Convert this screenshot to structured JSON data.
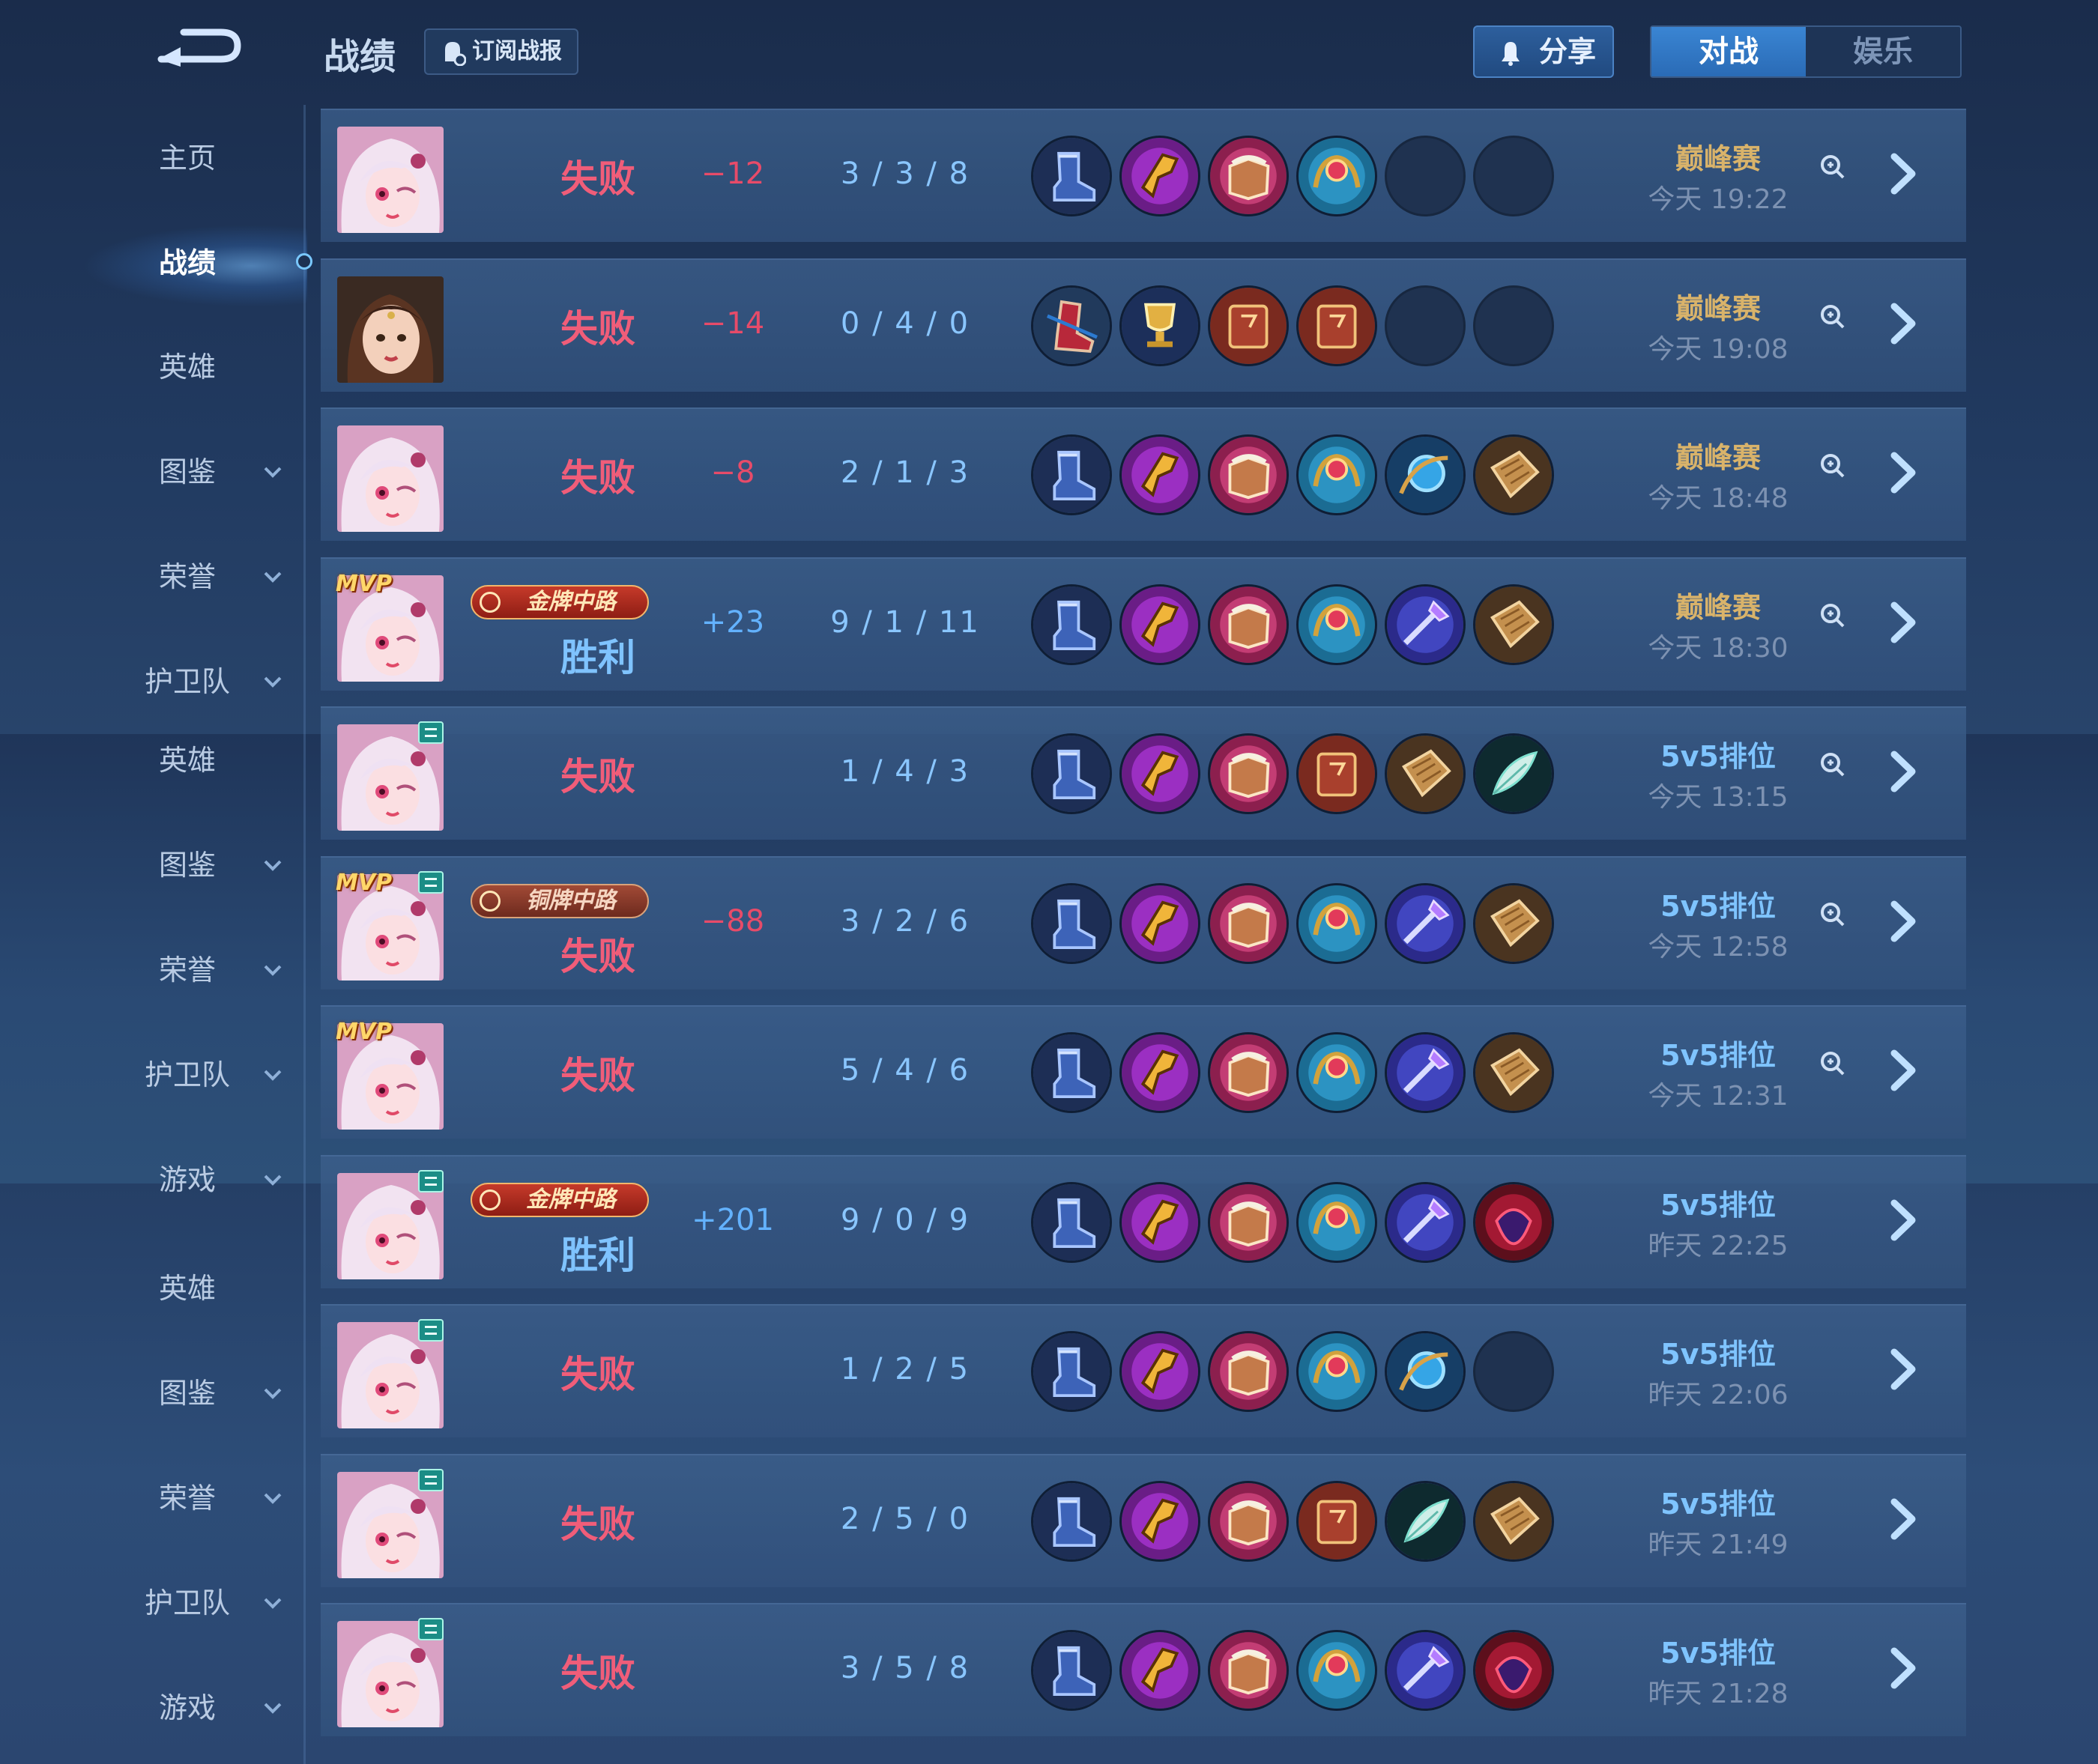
{
  "header": {
    "title": "战绩",
    "subscribe_label": "订阅战报",
    "share_label": "分享",
    "tabs": [
      "对战",
      "娱乐"
    ]
  },
  "sidebar": {
    "items": [
      {
        "label": "主页",
        "chevron": false
      },
      {
        "label": "战绩",
        "chevron": false,
        "active": true
      },
      {
        "label": "英雄",
        "chevron": false
      },
      {
        "label": "图鉴",
        "chevron": true
      },
      {
        "label": "荣誉",
        "chevron": true
      },
      {
        "label": "护卫队",
        "chevron": true
      },
      {
        "label": "英雄",
        "chevron": false
      },
      {
        "label": "图鉴",
        "chevron": true
      },
      {
        "label": "荣誉",
        "chevron": true
      },
      {
        "label": "护卫队",
        "chevron": true
      },
      {
        "label": "游戏",
        "chevron": true
      },
      {
        "label": "英雄",
        "chevron": false
      },
      {
        "label": "图鉴",
        "chevron": true
      },
      {
        "label": "荣誉",
        "chevron": true
      },
      {
        "label": "护卫队",
        "chevron": true
      },
      {
        "label": "游戏",
        "chevron": true
      }
    ]
  },
  "colors": {
    "loss": "#f05d79",
    "win": "#7fc3ff",
    "peak_mode": "#d9b36a",
    "rank_mode": "#7fc4ff",
    "accent": "#3a85d3"
  },
  "matches": [
    {
      "hero": "pink-hair-hero",
      "mvp": "",
      "rank_tag": false,
      "medal": "",
      "result": "失败",
      "score": "−12",
      "kda": "3 / 3 / 8",
      "items": [
        "boots",
        "golden-hammer",
        "tome",
        "orb-staff",
        "empty",
        "empty"
      ],
      "mode": "巅峰赛",
      "time": "今天 19:22",
      "detail_icon": true
    },
    {
      "hero": "brown-hair-hero",
      "mvp": "",
      "rank_tag": false,
      "medal": "",
      "result": "失败",
      "score": "−14",
      "kda": "0 / 4 / 0",
      "items": [
        "red-boots",
        "golden-cup",
        "red-tome",
        "red-tome",
        "empty",
        "empty"
      ],
      "mode": "巅峰赛",
      "time": "今天 19:08",
      "detail_icon": true
    },
    {
      "hero": "pink-hair-hero",
      "mvp": "",
      "rank_tag": false,
      "medal": "",
      "result": "失败",
      "score": "−8",
      "kda": "2 / 1 / 3",
      "items": [
        "boots",
        "golden-hammer",
        "tome",
        "orb-staff",
        "blue-orb",
        "wood-shield"
      ],
      "mode": "巅峰赛",
      "time": "今天 18:48",
      "detail_icon": true
    },
    {
      "hero": "pink-hair-hero",
      "mvp": "MVP",
      "rank_tag": false,
      "medal": "金牌中路",
      "medal_tier": "gold",
      "result": "胜利",
      "score": "+23",
      "kda": "9 / 1 / 11",
      "items": [
        "boots",
        "golden-hammer",
        "tome",
        "orb-staff",
        "purple-scepter",
        "wood-shield"
      ],
      "mode": "巅峰赛",
      "time": "今天 18:30",
      "detail_icon": true
    },
    {
      "hero": "pink-hair-hero",
      "mvp": "",
      "rank_tag": true,
      "medal": "",
      "result": "失败",
      "score": "",
      "kda": "1 / 4 / 3",
      "items": [
        "boots",
        "golden-hammer",
        "tome",
        "red-tome",
        "wood-shield",
        "feather"
      ],
      "mode": "5v5排位",
      "time": "今天 13:15",
      "detail_icon": true
    },
    {
      "hero": "pink-hair-hero",
      "mvp": "MVP",
      "rank_tag": true,
      "medal": "铜牌中路",
      "medal_tier": "bronze",
      "result": "失败",
      "score": "−88",
      "kda": "3 / 2 / 6",
      "items": [
        "boots",
        "golden-hammer",
        "tome",
        "orb-staff",
        "purple-scepter",
        "wood-shield"
      ],
      "mode": "5v5排位",
      "time": "今天 12:58",
      "detail_icon": true
    },
    {
      "hero": "pink-hair-hero",
      "mvp": "MVP",
      "rank_tag": false,
      "medal": "",
      "result": "失败",
      "score": "",
      "kda": "5 / 4 / 6",
      "items": [
        "boots",
        "golden-hammer",
        "tome",
        "orb-staff",
        "purple-scepter",
        "wood-shield"
      ],
      "mode": "5v5排位",
      "time": "今天 12:31",
      "detail_icon": true
    },
    {
      "hero": "pink-hair-hero",
      "mvp": "",
      "rank_tag": true,
      "medal": "金牌中路",
      "medal_tier": "gold",
      "result": "胜利",
      "score": "+201",
      "kda": "9 / 0 / 9",
      "items": [
        "boots",
        "golden-hammer",
        "tome",
        "orb-staff",
        "purple-scepter",
        "crimson-mask"
      ],
      "mode": "5v5排位",
      "time": "昨天 22:25",
      "detail_icon": false
    },
    {
      "hero": "pink-hair-hero",
      "mvp": "",
      "rank_tag": true,
      "medal": "",
      "result": "失败",
      "score": "",
      "kda": "1 / 2 / 5",
      "items": [
        "boots",
        "golden-hammer",
        "tome",
        "orb-staff",
        "blue-orb",
        "empty"
      ],
      "mode": "5v5排位",
      "time": "昨天 22:06",
      "detail_icon": false
    },
    {
      "hero": "pink-hair-hero",
      "mvp": "",
      "rank_tag": true,
      "medal": "",
      "result": "失败",
      "score": "",
      "kda": "2 / 5 / 0",
      "items": [
        "boots",
        "golden-hammer",
        "tome",
        "red-tome",
        "feather",
        "wood-shield"
      ],
      "mode": "5v5排位",
      "time": "昨天 21:49",
      "detail_icon": false
    },
    {
      "hero": "pink-hair-hero",
      "mvp": "",
      "rank_tag": true,
      "medal": "",
      "result": "失败",
      "score": "",
      "kda": "3 / 5 / 8",
      "items": [
        "boots",
        "golden-hammer",
        "tome",
        "orb-staff",
        "purple-scepter",
        "crimson-mask"
      ],
      "mode": "5v5排位",
      "time": "昨天 21:28",
      "detail_icon": false
    }
  ]
}
